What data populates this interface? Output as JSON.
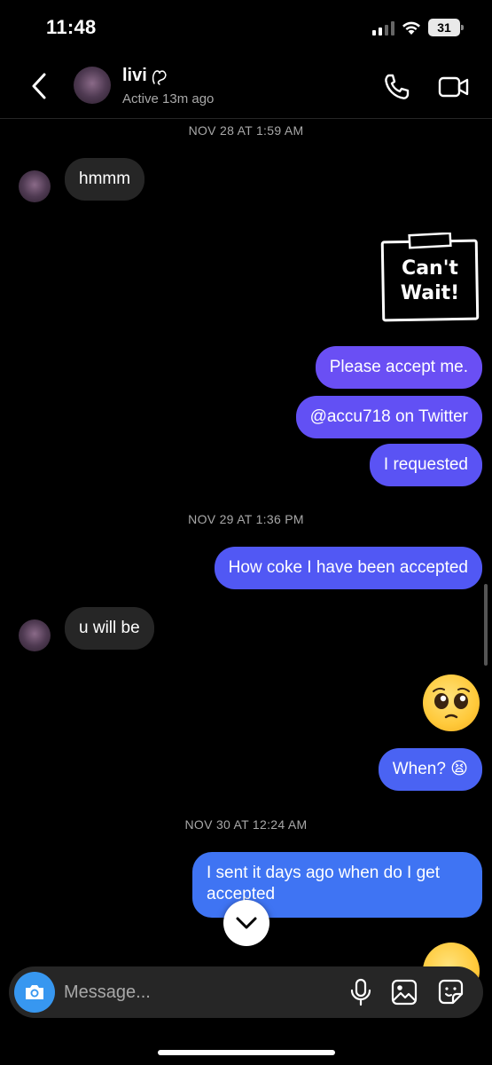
{
  "status_bar": {
    "time": "11:48",
    "battery": "31"
  },
  "header": {
    "name": "livi",
    "status": "Active 13m ago"
  },
  "messages": {
    "date1": "NOV 28 AT 1:59 AM",
    "m1": "hmmm",
    "sticker_text_line1": "Can't",
    "sticker_text_line2": "Wait!",
    "m2": "Please accept me.",
    "m3": "@accu718 on Twitter",
    "m4": "I requested",
    "date2": "NOV 29 AT 1:36 PM",
    "m5": "How coke I have been accepted",
    "m6": "u will be",
    "m7": "When? 😫",
    "date3": "NOV 30 AT 12:24 AM",
    "m8": "I sent it days ago when do I get accepted"
  },
  "composer": {
    "placeholder": "Message..."
  },
  "colors": {
    "sent_top": "#6c4df5",
    "sent_bottom": "#3c7ef3",
    "received": "#262626",
    "camera": "#3797f0"
  },
  "icons": [
    "back-icon",
    "heart-icon",
    "phone-icon",
    "video-camera-icon",
    "chevron-down-icon",
    "camera-icon",
    "microphone-icon",
    "gallery-icon",
    "sticker-icon"
  ]
}
